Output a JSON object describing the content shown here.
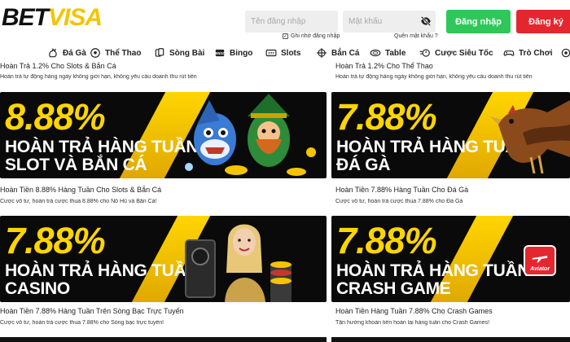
{
  "header": {
    "logo_part1": "BET",
    "logo_part2": "VISA",
    "username_placeholder": "Tên đăng nhập",
    "password_placeholder": "Mật khẩu",
    "remember_label": "Ghi nhớ đăng nhập",
    "forgot_label": "Quên mật khẩu ?",
    "login_label": "Đăng nhập",
    "register_label": "Đăng ký"
  },
  "nav": {
    "items": [
      {
        "label": "Đá Gà",
        "icon": "rooster-icon"
      },
      {
        "label": "Thể Thao",
        "icon": "soccer-ball-icon"
      },
      {
        "label": "Sòng Bài",
        "icon": "cards-icon"
      },
      {
        "label": "Bingo",
        "icon": "bingo-icon"
      },
      {
        "label": "Slots",
        "icon": "slots-icon"
      },
      {
        "label": "Bắn Cá",
        "icon": "fish-target-icon"
      },
      {
        "label": "Table",
        "icon": "table-icon"
      },
      {
        "label": "Cược Siêu Tốc",
        "icon": "fast-bet-icon"
      },
      {
        "label": "Trò Chơi",
        "icon": "game-controller-icon"
      }
    ]
  },
  "cut_row": {
    "left_title": "Hoàn Trả 1.2% Cho Slots & Bắn Cá",
    "left_desc": "Hoàn trả tự động hàng ngày không giới hạn, không yêu cầu doanh thu rút tiền",
    "right_title": "Hoàn Trả 1.2% Cho Thể Thao",
    "right_desc": "Hoàn trả tự động hàng ngày không giới hạn, không yêu cầu doanh thu rút tiền"
  },
  "promos": [
    {
      "pct": "8.88%",
      "line1": "HOÀN TRẢ HÀNG TUẦN",
      "line2": "SLOT VÀ BẮN CÁ",
      "title": "Hoàn Tiền 8.88% Hàng Tuần Cho Slots & Bắn Cá",
      "desc": "Cược vô tư, hoàn trả cược thua 8.88% cho Nổ Hũ và Bắn Cá!"
    },
    {
      "pct": "7.88%",
      "line1": "HOÀN TRẢ HÀNG TUẦN",
      "line2": "ĐÁ GÀ",
      "title": "Hoàn Tiền 7.88% Hàng Tuần Cho Đá Gà",
      "desc": "Cược vô tư, hoàn trả cược thua 7.88% cho Đá Gà"
    },
    {
      "pct": "7.88%",
      "line1": "HOÀN TRẢ HÀNG TUẦN",
      "line2": "CASINO",
      "title": "Hoàn Tiền 7.88% Hàng Tuần Trên Sòng Bạc Trực Tuyến",
      "desc": "Cược vô tư, hoàn trả cược thua 7.88% cho Sòng bạc trực tuyến!"
    },
    {
      "pct": "7.88%",
      "line1": "HOÀN TRẢ HÀNG TUẦN",
      "line2": "CRASH GAME",
      "badge": "Aviator",
      "title": "Hoàn Tiền Hàng Tuần 7.88% Cho Crash Games",
      "desc": "Tận hưởng khoản tiền hoàn lại hàng tuần cho Crash Games!"
    }
  ],
  "colors": {
    "brand_yellow": "#ffd500",
    "login_green": "#30c75a",
    "register_red": "#e4272f"
  }
}
